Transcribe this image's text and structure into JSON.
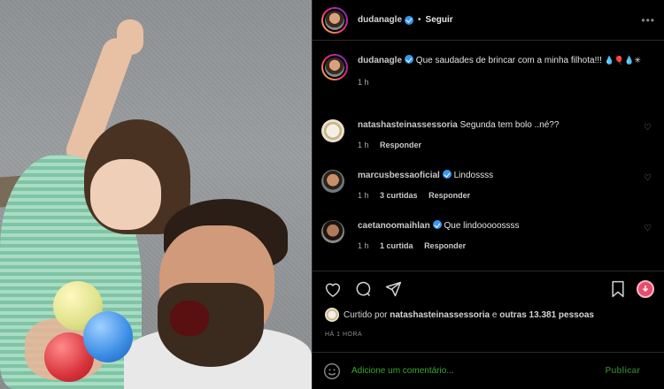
{
  "header": {
    "username": "dudanagle",
    "separator": "•",
    "follow_label": "Seguir",
    "more_label": "•••"
  },
  "caption": {
    "username": "dudanagle",
    "text": "Que saudades de brincar com a minha filhota!!!",
    "emoji_line": "💧🎈💧✳",
    "time": "1 h"
  },
  "comments": [
    {
      "username": "natashasteinassessoria",
      "verified": false,
      "text": "Segunda tem bolo ..né??",
      "time": "1 h",
      "likes": "",
      "reply_label": "Responder"
    },
    {
      "username": "marcusbessaoficial",
      "verified": true,
      "text": "Lindossss",
      "time": "1 h",
      "likes": "3 curtidas",
      "reply_label": "Responder"
    },
    {
      "username": "caetanoomaihlan",
      "verified": true,
      "text": "Que lindooooossss",
      "time": "1 h",
      "likes": "1 curtida",
      "reply_label": "Responder"
    }
  ],
  "likes": {
    "prefix": "Curtido por",
    "user": "natashasteinassessoria",
    "conjunction": "e",
    "others": "outras 13.381 pessoas"
  },
  "post_age": "HÁ 1 HORA",
  "add_comment": {
    "placeholder": "Adicione um comentário...",
    "publish_label": "Publicar"
  },
  "colors": {
    "verified": "#3897f0",
    "placeholder": "#3aa832",
    "publish": "#2d6b2a",
    "download": "#e84c6a"
  }
}
